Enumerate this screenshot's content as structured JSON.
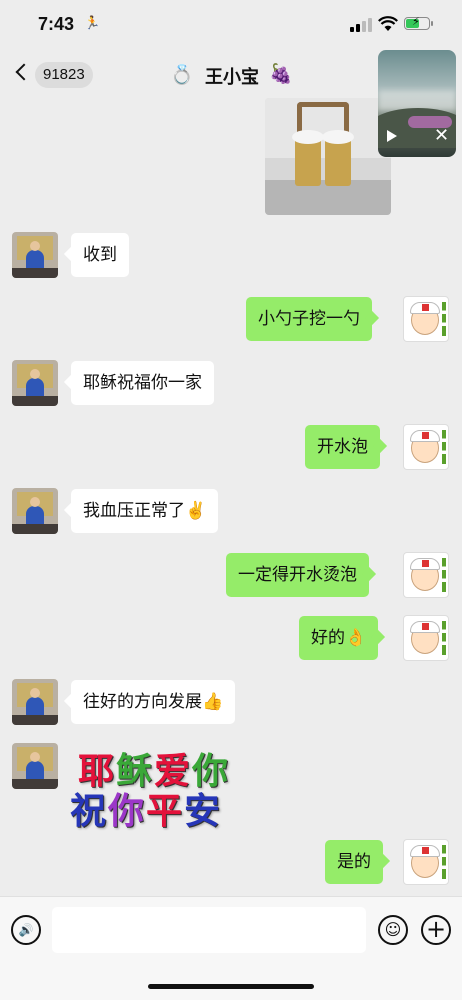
{
  "status_bar": {
    "time": "7:43",
    "activity_icon": "running-person-icon",
    "signal_icon": "cellular-signal-icon",
    "wifi_icon": "wifi-icon",
    "battery_icon": "battery-charging-icon",
    "battery_color": "#34c759"
  },
  "nav": {
    "back_icon": "chevron-left-icon",
    "unread_count": "91823",
    "title_prefix_icon": "💍",
    "title": "王小宝",
    "title_suffix_icon": "🍇"
  },
  "colors": {
    "background": "#ededed",
    "incoming_bubble": "#ffffff",
    "outgoing_bubble": "#95ec69"
  },
  "messages": [
    {
      "sender": "me",
      "type": "image",
      "image_name": "photo-two-cans-on-table"
    },
    {
      "sender": "other",
      "type": "text",
      "text": "收到"
    },
    {
      "sender": "me",
      "type": "text",
      "text": "小勺子挖一勺"
    },
    {
      "sender": "other",
      "type": "text",
      "text": "耶稣祝福你一家"
    },
    {
      "sender": "me",
      "type": "text",
      "text": "开水泡"
    },
    {
      "sender": "other",
      "type": "text",
      "text": "我血压正常了✌️"
    },
    {
      "sender": "me",
      "type": "text",
      "text": "一定得开水烫泡"
    },
    {
      "sender": "me",
      "type": "text",
      "text": "好的👌"
    },
    {
      "sender": "other",
      "type": "text",
      "text": "往好的方向发展👍"
    },
    {
      "sender": "other",
      "type": "sticker",
      "line1": "耶稣爱你",
      "line2": "祝你平安"
    },
    {
      "sender": "me",
      "type": "text",
      "text": "是的"
    }
  ],
  "floating_video": {
    "play_icon": "play-icon",
    "close_label": "✕"
  },
  "input_bar": {
    "voice_icon": "voice-input-icon",
    "voice_glyph": "🔊",
    "text_value": "",
    "emoji_icon": "emoji-icon",
    "emoji_glyph": "☺",
    "plus_icon": "plus-icon",
    "plus_glyph": "+"
  }
}
